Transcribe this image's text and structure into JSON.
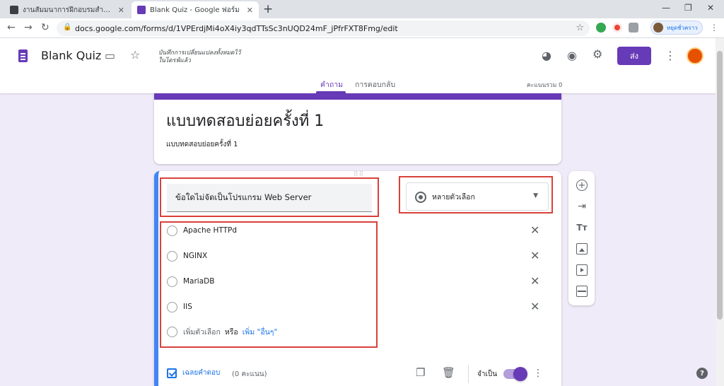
{
  "browser": {
    "tabs": [
      {
        "title": "งานสัมมนาการฝึกอบรมสำหรับ Web Programming",
        "favicon_color": "#3c4043"
      },
      {
        "title": "Blank Quiz - Google ฟอร์ม",
        "favicon_color": "#673ab7"
      }
    ],
    "url": "docs.google.com/forms/d/1VPErdjMi4oX4iy3qdTTsSc3nUQD24mF_jPfrFXT8Fmg/edit",
    "profile_label": "หยุดชั่วคราว"
  },
  "header": {
    "form_name": "Blank Quiz",
    "saved_message_line1": "บันทึกการเปลี่ยนแปลงทั้งหมดไว้",
    "saved_message_line2": "ในไดรฟ์แล้ว",
    "send_label": "ส่ง",
    "tabs": [
      {
        "label": "คำถาม",
        "active": true
      },
      {
        "label": "การตอบกลับ",
        "active": false
      }
    ],
    "total_score": "คะแนนรวม 0"
  },
  "title_card": {
    "title": "แบบทดสอบย่อยครั้งที่ 1",
    "description": "แบบทดสอบย่อยครั้งที่ 1"
  },
  "question": {
    "text": "ข้อใดไม่จัดเป็นโปรแกรม Web Server",
    "type": "หลายตัวเลือก",
    "options": [
      "Apache HTTPd",
      "NGINX",
      "MariaDB",
      "IIS"
    ],
    "add_option": "เพิ่มตัวเลือก",
    "or": "หรือ",
    "add_other": "เพิ่ม \"อื่นๆ\"",
    "answer_key": "เฉลยคำตอบ",
    "points": "(0 คะแนน)",
    "required_label": "จำเป็น",
    "required": true
  },
  "colors": {
    "accent": "#673ab7",
    "annotation": "#d9413a",
    "active_border": "#4285f4",
    "background": "#f0ebf8"
  }
}
